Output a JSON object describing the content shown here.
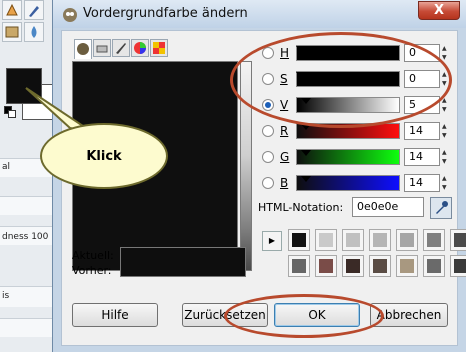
{
  "window": {
    "title": "Vordergrundfarbe ändern",
    "close_glyph": "X"
  },
  "background_app": {
    "labels": [
      "al",
      "dness 100",
      "is"
    ]
  },
  "callout": {
    "text": "Klick"
  },
  "color_selector": {
    "current_label": "Aktuell:",
    "previous_label": "Vorher:"
  },
  "channels": [
    {
      "key": "H",
      "value": "0",
      "selected": false,
      "gradient": "linear-gradient(to right,#000,#000)"
    },
    {
      "key": "S",
      "value": "0",
      "selected": false,
      "gradient": "linear-gradient(to right,#000,#000)"
    },
    {
      "key": "V",
      "value": "5",
      "selected": true,
      "gradient": "linear-gradient(to right,#000,#fff)"
    },
    {
      "key": "R",
      "value": "14",
      "selected": false,
      "gradient": "linear-gradient(to right,#0e0e0e,#ff0e0e)"
    },
    {
      "key": "G",
      "value": "14",
      "selected": false,
      "gradient": "linear-gradient(to right,#0e0e0e,#0eff0e)"
    },
    {
      "key": "B",
      "value": "14",
      "selected": false,
      "gradient": "linear-gradient(to right,#0e0e0e,#0e0eff)"
    }
  ],
  "html_notation": {
    "label": "HTML-Notation:",
    "value": "0e0e0e"
  },
  "history_colors": [
    [
      "#111111",
      "#c9c9c9",
      "#c0c0c0",
      "#b5b5b5",
      "#a6a6a6",
      "#7f7f7f",
      "#4a4a4a"
    ],
    [
      "#666666",
      "#7a4c48",
      "#3a2a26",
      "#5a4c44",
      "#a89880",
      "#6a6a6a",
      "#3a3a3a"
    ]
  ],
  "buttons": {
    "help": "Hilfe",
    "reset": "Zurücksetzen",
    "ok": "OK",
    "cancel": "Abbrechen"
  },
  "colors": {
    "current_color": "#0e0e0e",
    "highlight": "#b84a2d",
    "callout_fill": "#fdfbcf"
  }
}
